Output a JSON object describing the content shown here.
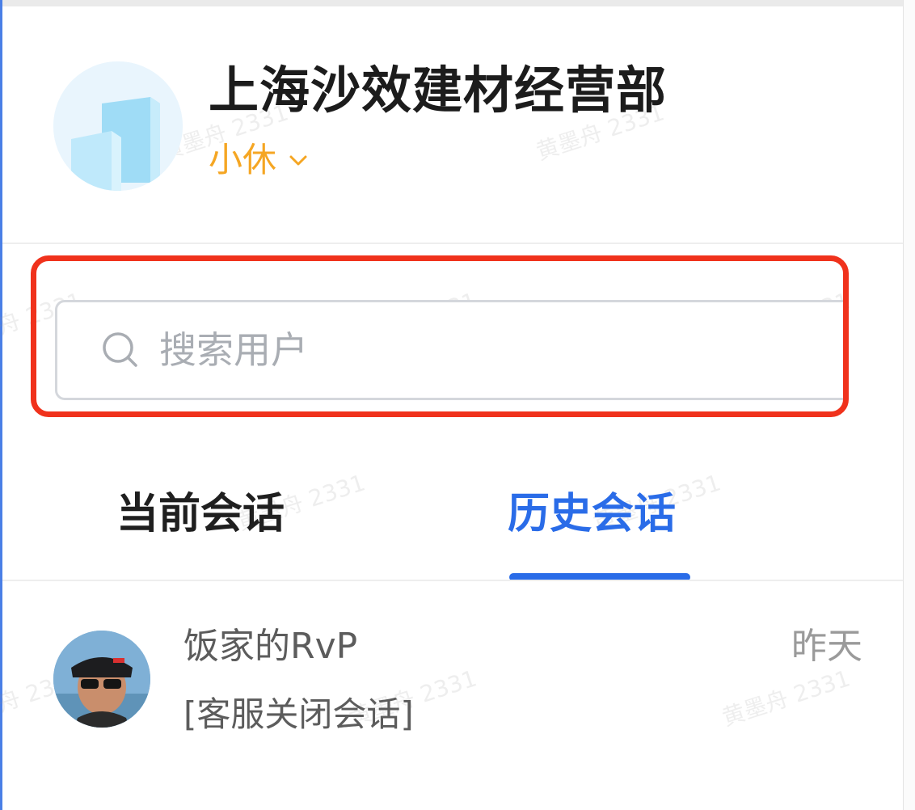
{
  "header": {
    "shop_name": "上海沙效建材经营部",
    "status_label": "小休",
    "status_icon": "chevron-down-icon",
    "logo_icon": "building-icon"
  },
  "search": {
    "placeholder": "搜索用户",
    "value": "",
    "icon": "search-icon",
    "highlight_color": "#f0321c"
  },
  "tabs": [
    {
      "label": "当前会话",
      "active": false
    },
    {
      "label": "历史会话",
      "active": true
    }
  ],
  "conversations": [
    {
      "name": "饭家的RvP",
      "preview": "[客服关闭会话]",
      "time": "昨天"
    }
  ],
  "watermark_text": "黄墨舟 2331",
  "colors": {
    "accent": "#2a6ce8",
    "status": "#f5a623",
    "highlight": "#f0321c"
  }
}
